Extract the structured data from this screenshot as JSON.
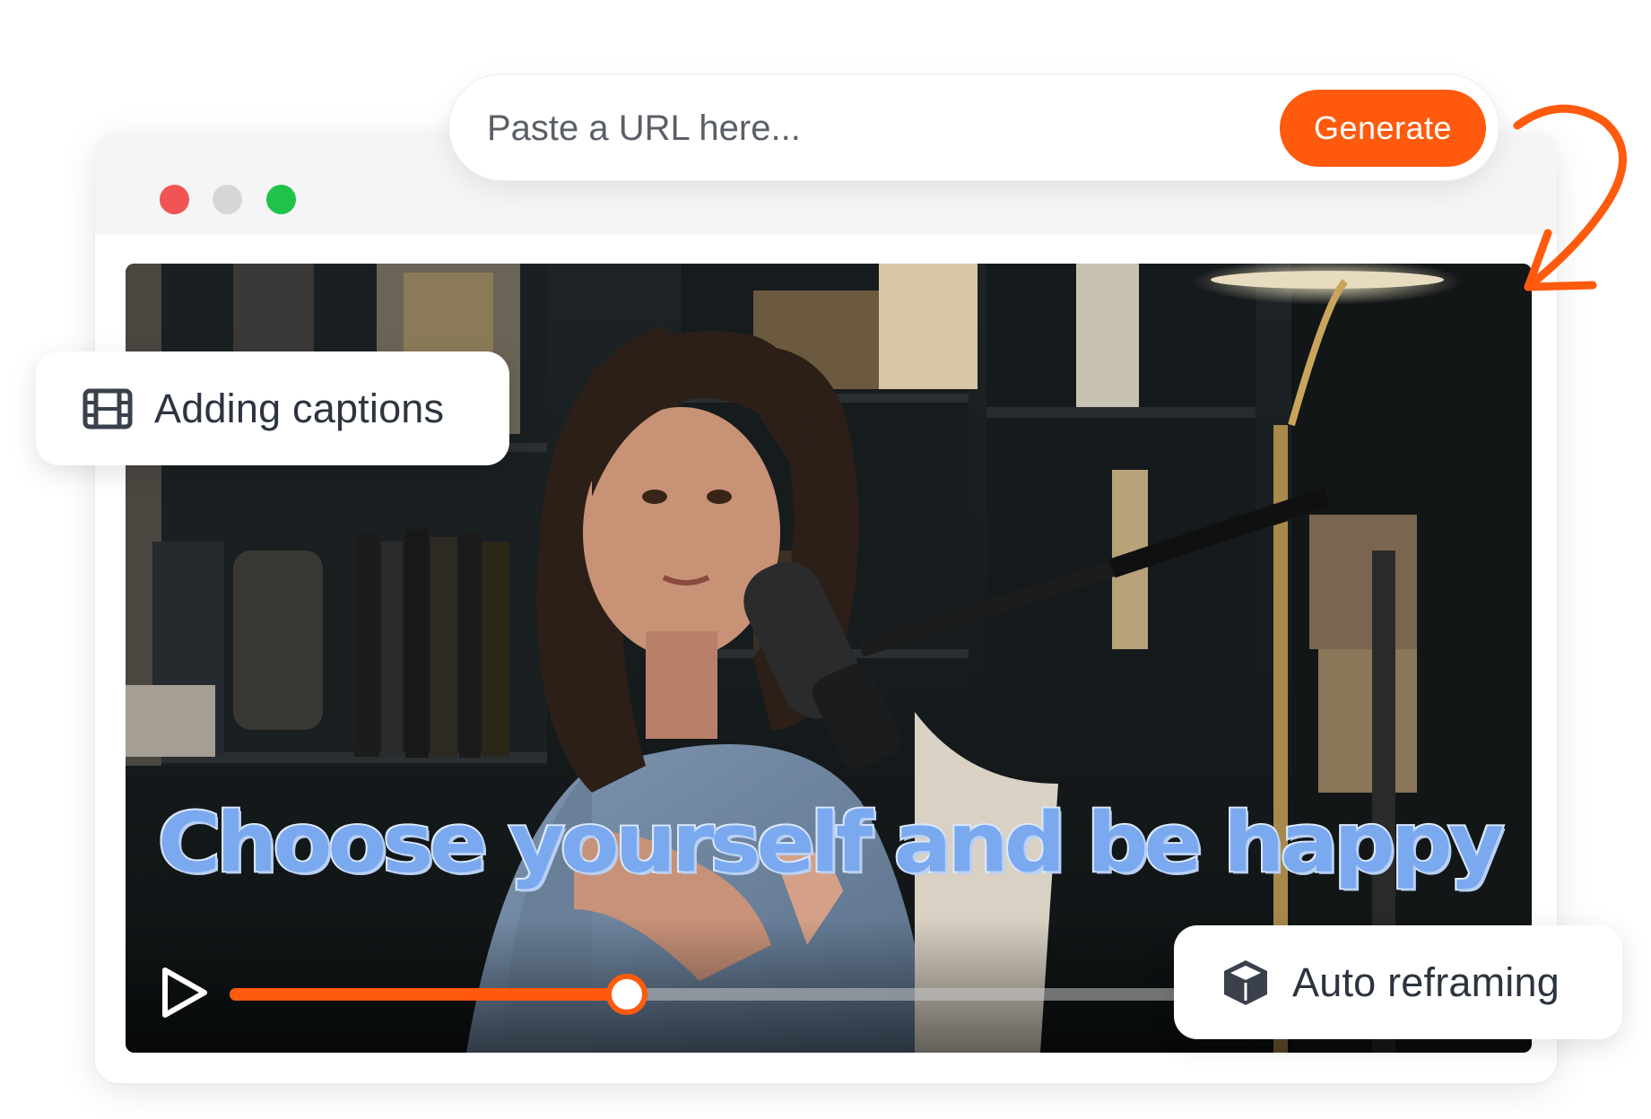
{
  "url_bar": {
    "placeholder": "Paste a URL here...",
    "generate_label": "Generate"
  },
  "video": {
    "caption": "Choose yourself and be happy",
    "progress": 0.31
  },
  "features": {
    "captions_label": "Adding captions",
    "captions_icon": "film-icon",
    "reframe_label": "Auto reframing",
    "reframe_icon": "cube-icon"
  },
  "colors": {
    "accent": "#ff5a0d",
    "caption_fill": "#7aa9ef",
    "window_red": "#f05454",
    "window_gray": "#d6d6d6",
    "window_green": "#1fc24a"
  }
}
